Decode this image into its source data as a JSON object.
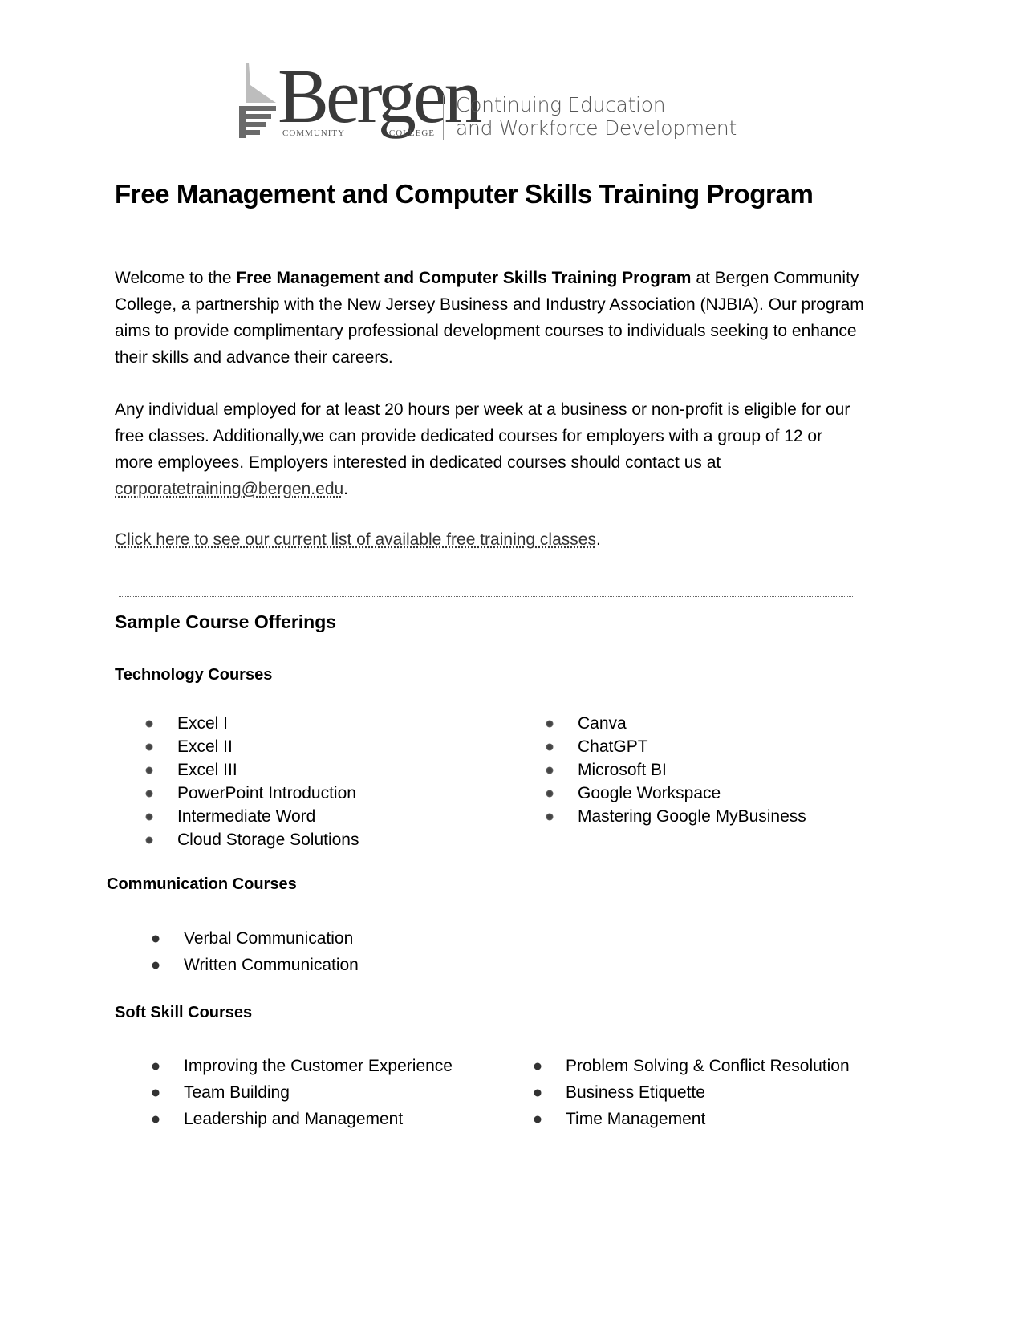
{
  "header": {
    "logo_name": "Bergen",
    "logo_sub_left": "COMMUNITY",
    "logo_sub_right": "COLLEGE",
    "department_line1": "Continuing Education",
    "department_line2": "and Workforce Development"
  },
  "title": "Free Management and Computer Skills Training Program",
  "intro": {
    "prefix": "Welcome to the ",
    "program_name": "Free Management and Computer Skills Training Program",
    "suffix": " at Bergen Community College, a partnership with the New Jersey Business and Industry Association (NJBIA). Our program aims to provide complimentary professional development courses to individuals seeking to enhance their skills and advance their careers."
  },
  "eligibility": {
    "text": "Any individual employed for at least 20 hours per week at a business or non-profit is eligible for our free classes.  Additionally,we can provide dedicated courses for employers with a group of 12 or more employees. Employers interested in dedicated courses should contact us at ",
    "email": "corporatetraining@bergen.edu",
    "end": "."
  },
  "classes_link": {
    "text": "Click here to see our current list of available free training classes",
    "end": "."
  },
  "sample_heading": "Sample Course Offerings",
  "sections": {
    "technology": {
      "heading": "Technology Courses",
      "left": [
        "Excel I",
        "Excel II",
        "Excel III",
        "PowerPoint Introduction",
        "Intermediate Word",
        "Cloud Storage Solutions"
      ],
      "right": [
        "Canva",
        "ChatGPT",
        "Microsoft BI",
        "Google Workspace",
        "Mastering Google MyBusiness"
      ]
    },
    "communication": {
      "heading": "Communication Courses",
      "items": [
        "Verbal Communication",
        "Written Communication"
      ]
    },
    "soft_skills": {
      "heading": "Soft Skill Courses",
      "left": [
        "Improving the Customer Experience",
        "Team Building",
        "Leadership and Management"
      ],
      "right": [
        "Problem Solving & Conflict Resolution",
        "Business Etiquette",
        "Time Management"
      ]
    }
  }
}
